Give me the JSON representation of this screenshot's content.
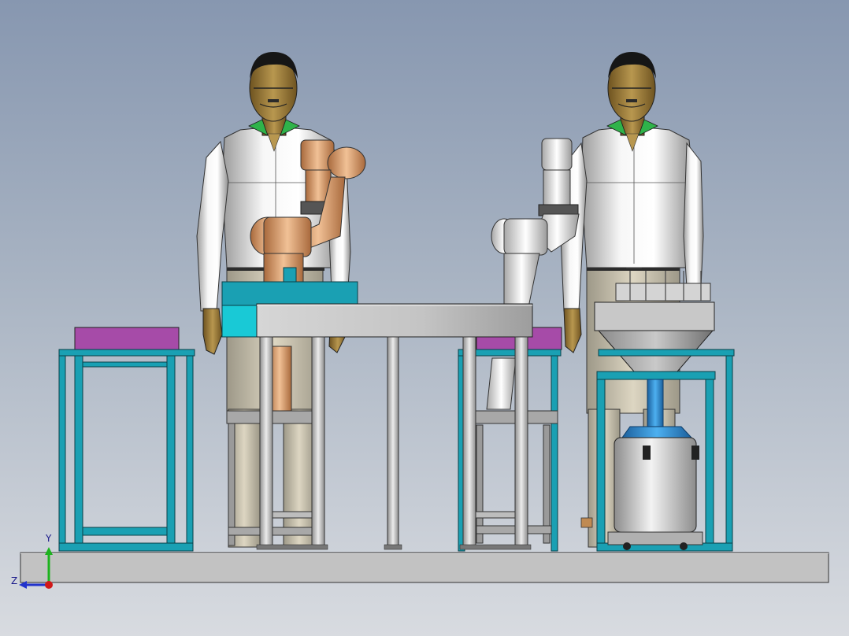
{
  "scene": {
    "background_top": "#8797b0",
    "background_bottom": "#d8dbe0",
    "colors": {
      "frame_teal": "#1aa0b3",
      "frame_dark": "#0e6f7e",
      "pad_magenta": "#a64ba8",
      "table_gray": "#bdbdbd",
      "shirt_white": "#f2f2f2",
      "pants_beige": "#cfc8b2",
      "skin": "#9a7b3c",
      "collar_green": "#2fb34a",
      "robot_bronze": "#d49a6a",
      "robot_silver": "#e3e3e3",
      "hopper_gray": "#8c8c8c",
      "vessel_blue": "#2a8fd8",
      "base_plate": "#bfbfbf"
    },
    "objects": [
      "left-operator",
      "right-operator",
      "bronze-robot-arm",
      "silver-robot-arm",
      "center-workbench",
      "left-stand",
      "right-stand",
      "hopper-station",
      "base-plate"
    ]
  },
  "triad": {
    "x_label": "",
    "y_label": "Y",
    "z_label": "Z",
    "y_color": "#1db31d",
    "z_color": "#2233cc",
    "x_color": "#d01818"
  }
}
